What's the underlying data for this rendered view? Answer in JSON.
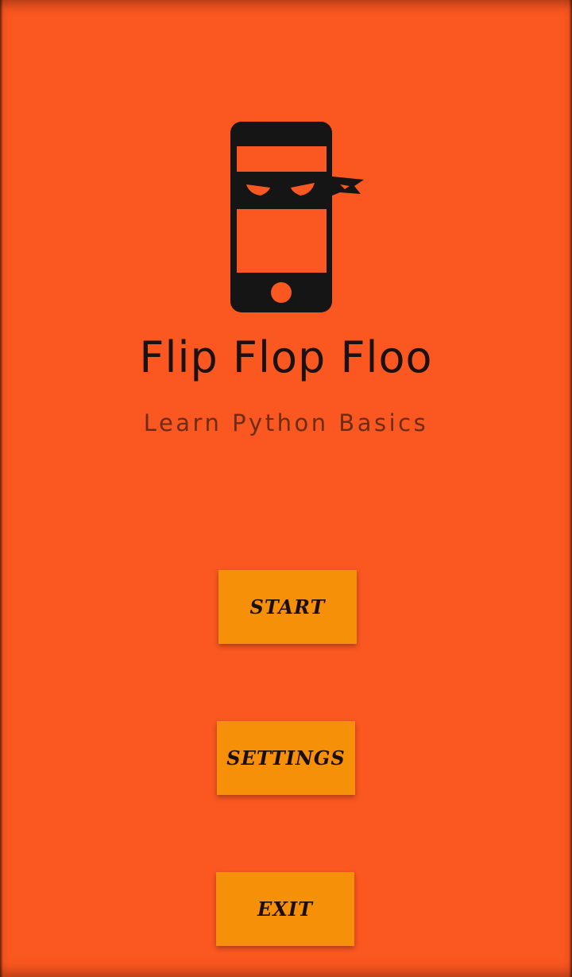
{
  "app": {
    "title": "Flip Flop Floo",
    "subtitle": "Learn Python Basics",
    "logo_icon": "ninja-phone-icon"
  },
  "menu": {
    "start_label": "START",
    "settings_label": "SETTINGS",
    "exit_label": "EXIT"
  },
  "colors": {
    "background": "#fb5720",
    "button": "#f79009",
    "logo_dark": "#151515",
    "title_text": "#1a1110",
    "subtitle_text": "#6b2d15"
  }
}
